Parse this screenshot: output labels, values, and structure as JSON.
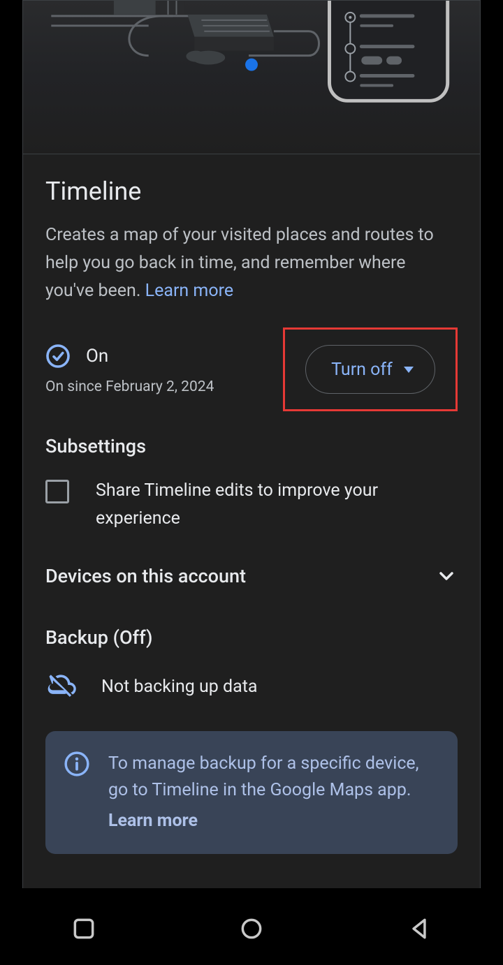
{
  "timeline": {
    "title": "Timeline",
    "description_prefix": "Creates a map of your visited places and routes to help you go back in time, and remember where you've been. ",
    "learn_more": "Learn more",
    "status_label": "On",
    "status_since": "On since February 2, 2024",
    "turn_off_label": "Turn off"
  },
  "subsettings": {
    "heading": "Subsettings",
    "share_edits_label": "Share Timeline edits to improve your experience",
    "share_edits_checked": false
  },
  "devices": {
    "heading": "Devices on this account"
  },
  "backup": {
    "heading": "Backup (Off)",
    "status_text": "Not backing up data"
  },
  "info": {
    "message": "To manage backup for a specific device, go to Timeline in the Google Maps app.",
    "learn_more": "Learn more"
  },
  "highlight": {
    "target": "turn-off-button",
    "color": "#e53935"
  }
}
